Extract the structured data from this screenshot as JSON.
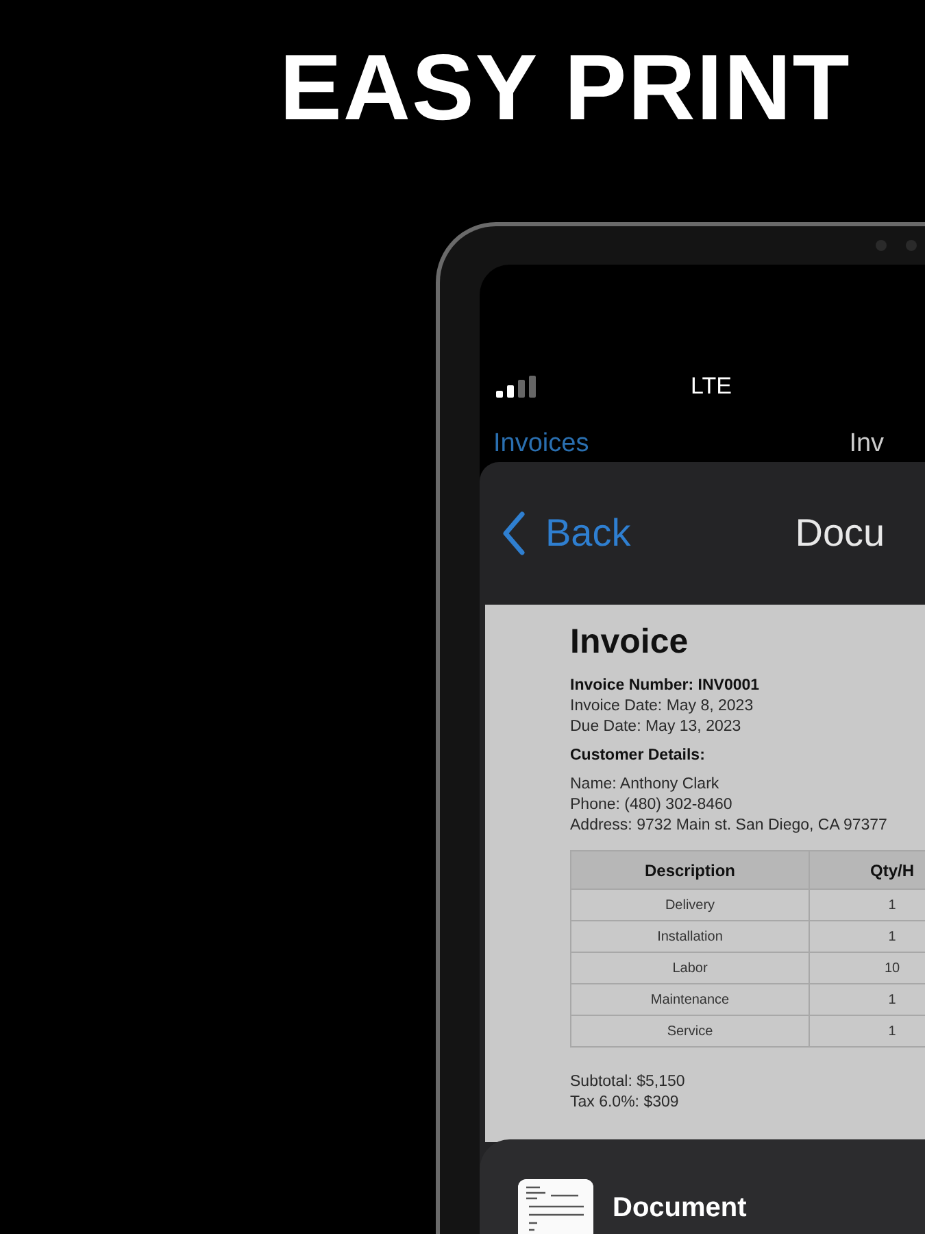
{
  "headline": "EASY PRINT",
  "status_bar": {
    "network": "LTE"
  },
  "background_nav": {
    "back": "Invoices",
    "title": "Inv"
  },
  "nav_bar": {
    "back": "Back",
    "title": "Docu"
  },
  "invoice": {
    "title": "Invoice",
    "number": "Invoice Number: INV0001",
    "dates": [
      "Invoice Date: May 8, 2023",
      "Due Date: May 13, 2023"
    ],
    "customer_heading": "Customer Details:",
    "customer_lines": [
      "Name: Anthony Clark",
      "Phone: (480) 302-8460",
      "Address: 9732 Main st. San Diego, CA 97377"
    ],
    "table": {
      "columns": [
        "Description",
        "Qty/H"
      ],
      "rows": [
        [
          "Delivery",
          "1"
        ],
        [
          "Installation",
          "1"
        ],
        [
          "Labor",
          "10"
        ],
        [
          "Maintenance",
          "1"
        ],
        [
          "Service",
          "1"
        ]
      ]
    },
    "totals": [
      "Subtotal: $5,150",
      "Tax 6.0%: $309"
    ]
  },
  "bottom_sheet": {
    "title": "Document"
  }
}
